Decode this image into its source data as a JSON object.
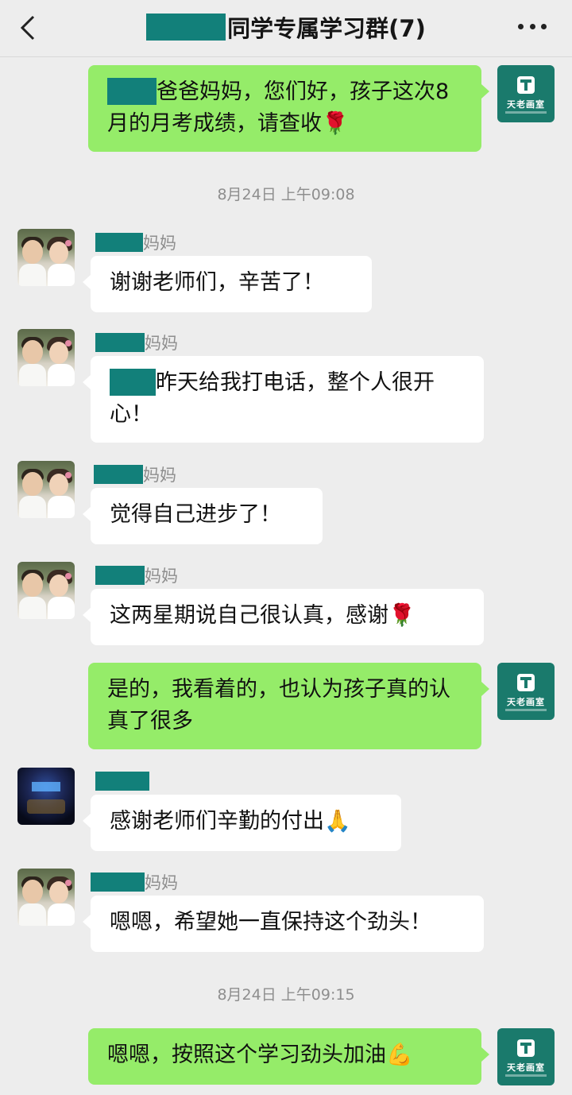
{
  "header": {
    "title": "同学专属学习群(7)"
  },
  "timestamps": [
    "8月24日 上午09:08",
    "8月24日 上午09:15"
  ],
  "avatar_brand": "天老画室",
  "colors": {
    "self_bubble": "#95ec69",
    "other_bubble": "#ffffff",
    "background": "#ededed",
    "redaction": "#12807a"
  },
  "messages": [
    {
      "from": "self",
      "text": "爸爸妈妈，您们好，孩子这次8月的月考成绩，请查收",
      "emoji": "🌹"
    },
    {
      "from": "other",
      "sender_suffix": "妈妈",
      "text": "谢谢老师们，辛苦了！"
    },
    {
      "from": "other",
      "sender_suffix": "妈妈",
      "text": "昨天给我打电话，整个人很开心！"
    },
    {
      "from": "other",
      "sender_suffix": "妈妈",
      "text": "觉得自己进步了！"
    },
    {
      "from": "other",
      "sender_suffix": "妈妈",
      "text": "这两星期说自己很认真，感谢",
      "emoji": "🌹"
    },
    {
      "from": "self",
      "text": "是的，我看着的，也认为孩子真的认真了很多"
    },
    {
      "from": "other",
      "sender_suffix": "",
      "text": "感谢老师们辛勤的付出",
      "emoji": "🙏"
    },
    {
      "from": "other",
      "sender_suffix": "妈妈",
      "text": "嗯嗯，希望她一直保持这个劲头！"
    },
    {
      "from": "self",
      "text": "嗯嗯，按照这个学习劲头加油",
      "emoji": "💪"
    }
  ]
}
